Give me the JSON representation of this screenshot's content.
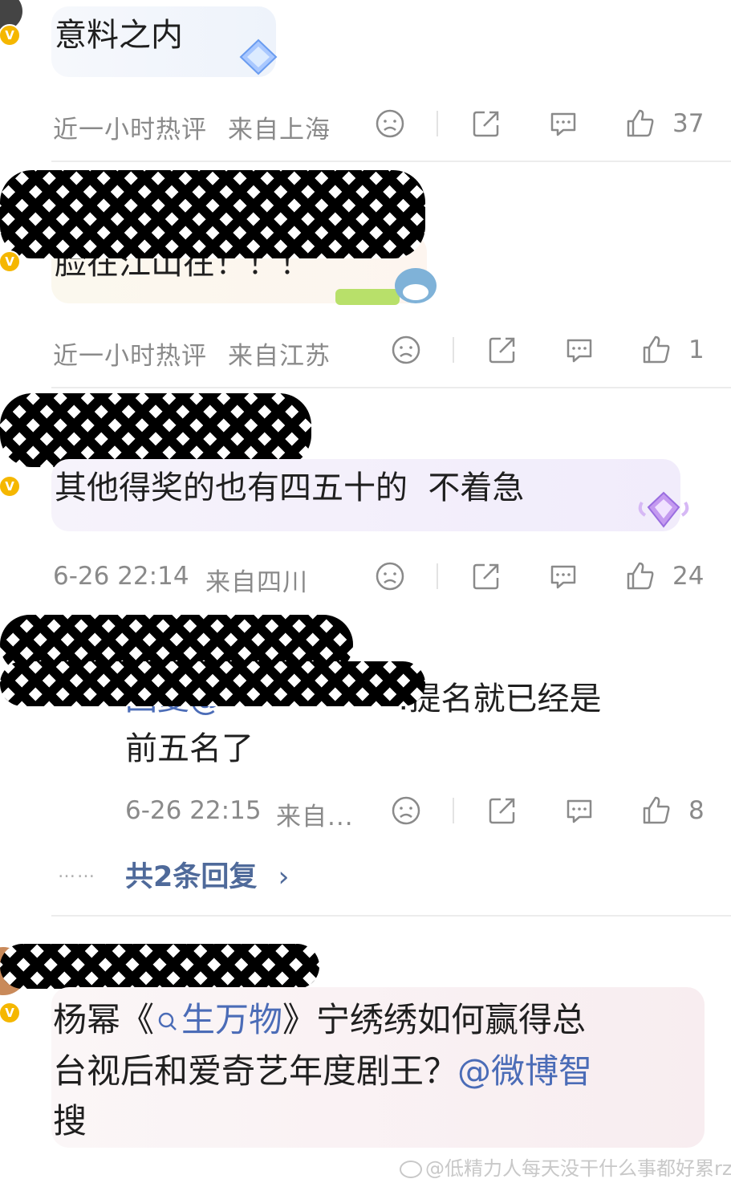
{
  "comments": [
    {
      "text": "意料之内",
      "time": "近一小时热评",
      "location": "来自上海",
      "likes": "37"
    },
    {
      "text": "脸在江山在！！！",
      "time": "近一小时热评",
      "location": "来自江苏",
      "likes": "1"
    },
    {
      "text": "其他得奖的也有四五十的  不着急",
      "time": "6-26 22:14",
      "location": "来自四川",
      "likes": "24"
    }
  ],
  "reply": {
    "text_prefix": "回复@",
    "text_suffix": ":提名就已经是",
    "text_line2": "前五名了",
    "time": "6-26 22:15",
    "location": "来自...",
    "likes": "8"
  },
  "more_replies": {
    "dots": "……",
    "label": "共2条回复",
    "arrow": "›"
  },
  "last_comment": {
    "part1": "杨幂《",
    "link": "生万物",
    "part2": "》宁绣绣如何赢得总",
    "line2_a": "台视后和爱奇艺年度剧王？",
    "line2_mention": "@微博智",
    "line3_mention": "搜"
  },
  "badge_letter": "V",
  "watermark": "@低精力人每天没干什么事都好累rz",
  "icons": {
    "dislike": "sad-face-icon",
    "share": "share-icon",
    "comment": "comment-icon",
    "like": "thumbs-up-icon",
    "search": "search-icon",
    "badge": "verified-badge-icon"
  },
  "colors": {
    "meta_gray": "#8a8a8a",
    "link_blue": "#4b6cb7",
    "badge_gold": "#f5b700"
  }
}
